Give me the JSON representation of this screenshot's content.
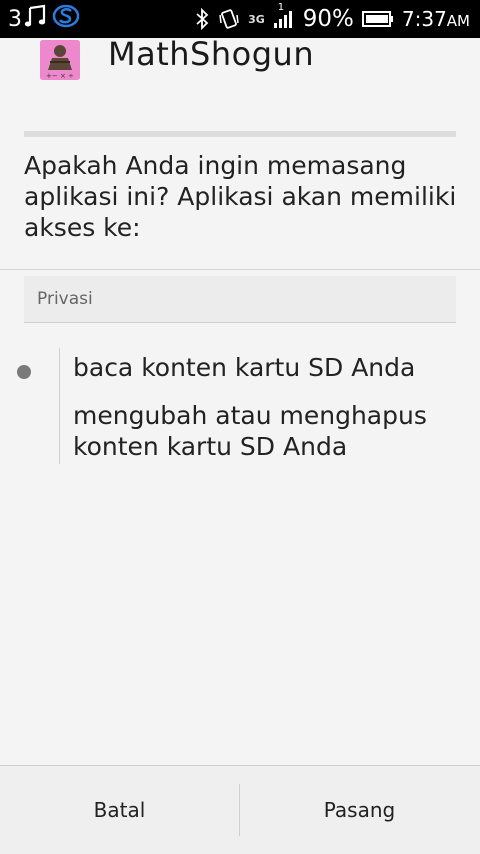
{
  "status_bar": {
    "notification_count": "3",
    "battery_percent": "90%",
    "network_type": "3G",
    "signal_badge": "1",
    "time": "7:37",
    "ampm": "AM",
    "icons": [
      "music-note-icon",
      "s-app-icon",
      "bluetooth-icon",
      "vibrate-icon",
      "signal-icon",
      "battery-icon"
    ]
  },
  "app": {
    "name": "MathShogun",
    "icon_colors": {
      "background": "#ee88cc",
      "figure": "#5a4636"
    }
  },
  "prompt": {
    "question": "Apakah Anda ingin memasang aplikasi ini? Aplikasi akan memiliki akses ke:"
  },
  "permissions": {
    "section_title": "Privasi",
    "items": [
      "baca konten kartu SD Anda",
      "mengubah atau menghapus konten kartu SD Anda"
    ]
  },
  "buttons": {
    "cancel": "Batal",
    "install": "Pasang"
  }
}
